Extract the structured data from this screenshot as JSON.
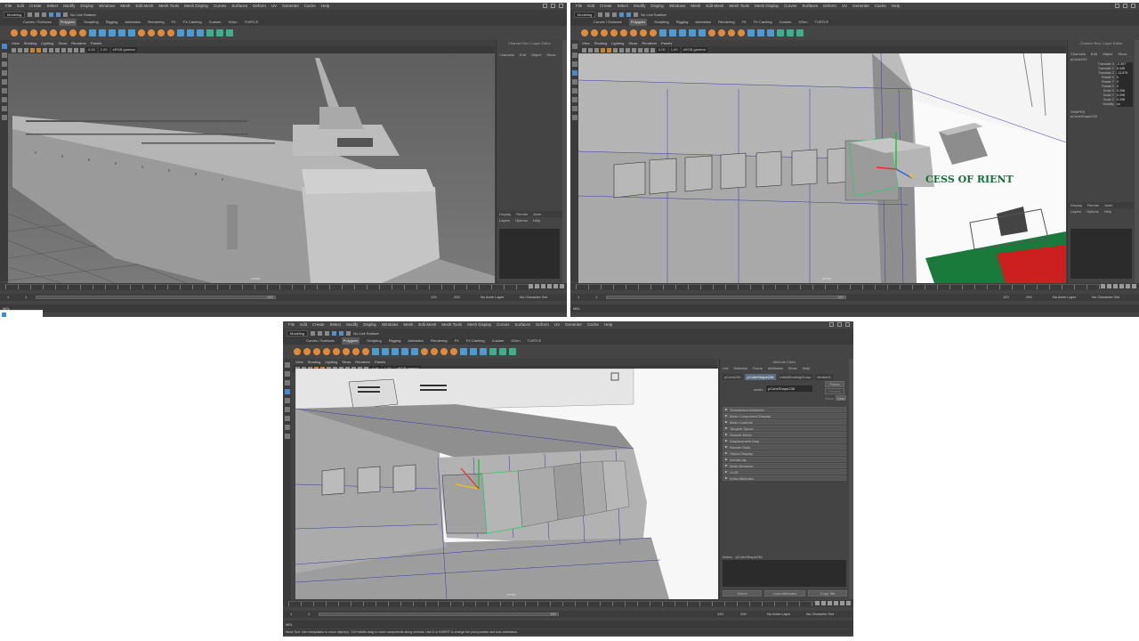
{
  "menu": [
    "File",
    "Edit",
    "Create",
    "Select",
    "Modify",
    "Display",
    "Windows",
    "Mesh",
    "Edit Mesh",
    "Mesh Tools",
    "Mesh Display",
    "Curves",
    "Surfaces",
    "Deform",
    "UV",
    "Generate",
    "Cache",
    "Help"
  ],
  "status": {
    "mode": "Modeling",
    "live": "No Live Surface"
  },
  "shelf_tabs": [
    "Curves / Surfaces",
    "Polygons",
    "Sculpting",
    "Rigging",
    "Animation",
    "Rendering",
    "FX",
    "FX Caching",
    "Custom",
    "XGen",
    "TURTLE"
  ],
  "shelf_active": "Polygons",
  "viewport_menu": [
    "View",
    "Shading",
    "Lighting",
    "Show",
    "Renderer",
    "Panels"
  ],
  "viewport_toolbar": {
    "value1": "0.00",
    "value2": "1.00",
    "colorspace": "sRGB gamma"
  },
  "persp": "persp",
  "channel_box": {
    "title": "Channel Box / Layer Editor",
    "tabs": [
      "Channels",
      "Edit",
      "Object",
      "Show"
    ],
    "object": "pCube233",
    "rows": [
      {
        "label": "Translate X",
        "value": "-0.397"
      },
      {
        "label": "Translate Y",
        "value": "6.445"
      },
      {
        "label": "Translate Z",
        "value": "-13.879"
      },
      {
        "label": "Rotate X",
        "value": "0"
      },
      {
        "label": "Rotate Y",
        "value": "0"
      },
      {
        "label": "Rotate Z",
        "value": "0"
      },
      {
        "label": "Scale X",
        "value": "0.298"
      },
      {
        "label": "Scale Y",
        "value": "0.298"
      },
      {
        "label": "Scale Z",
        "value": "0.298"
      },
      {
        "label": "Visibility",
        "value": "on"
      }
    ],
    "shapes_label": "SHAPES",
    "shape": "pCubeShape233"
  },
  "layer_editor": {
    "tabs": [
      "Display",
      "Render",
      "Anim"
    ],
    "menu": [
      "Layers",
      "Options",
      "Help"
    ]
  },
  "timeline": {
    "start": "1",
    "end": "120",
    "range_start": "1",
    "range_end": "120",
    "range_end2": "120",
    "range_total": "200",
    "current": "1"
  },
  "anim_layer": "No Anim Layer",
  "char_set": "No Character Set",
  "cmd_label": "MEL",
  "attribute_editor": {
    "title": "Attribute Editor",
    "menu": [
      "List",
      "Selected",
      "Focus",
      "Attributes",
      "Show",
      "Help"
    ],
    "tabs": [
      "pCube236",
      "pCubeShape236",
      "initialShadingGroup",
      "lambert1"
    ],
    "mesh_label": "mesh:",
    "mesh_value": "pCubeShape236",
    "focus": "Focus",
    "presets": "Presets",
    "show": "Show",
    "hide": "Hide",
    "sections": [
      "Tessellation Attributes",
      "Mesh Component Display",
      "Mesh Controls",
      "Tangent Space",
      "Smooth Mesh",
      "Displacement Map",
      "Render Stats",
      "Object Display",
      "mental ray",
      "Node Behavior",
      "UUID",
      "Extra Attributes"
    ],
    "notes_label": "Notes:",
    "notes_value": "pCubeShape236",
    "buttons": [
      "Select",
      "Load Attributes",
      "Copy Tab"
    ]
  },
  "ship_text": "CESS OF  RIENT",
  "help_line": "Move Tool: Use manipulator to move object(s). Ctrl+middle-drag to move components along normals. Use D or INSERT to change the pivot position and axis orientation."
}
